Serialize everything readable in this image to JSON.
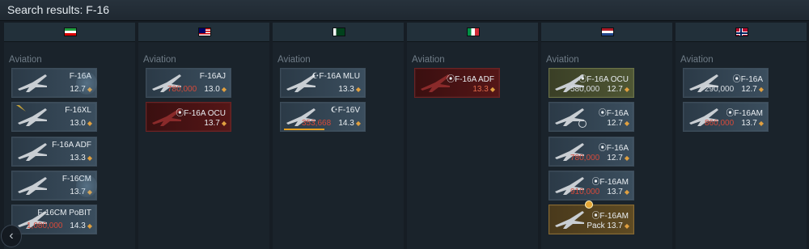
{
  "header": {
    "title": "Search results: F-16"
  },
  "colors": {
    "background": "#161d24",
    "accent_gold": "#e0a040",
    "price_red": "#d64a3a"
  },
  "columns": [
    {
      "country_flag": "iran-flag",
      "section": "Aviation",
      "cards": [
        {
          "name": "F-16A",
          "br": "12.7",
          "price": "",
          "style": "normal"
        },
        {
          "name": "F-16XL",
          "br": "13.0",
          "price": "",
          "style": "normal"
        },
        {
          "name": "F-16A ADF",
          "br": "13.3",
          "price": "",
          "style": "normal"
        },
        {
          "name": "F-16CM",
          "br": "13.7",
          "price": "",
          "style": "normal"
        },
        {
          "name": "F-16CM PoBIT",
          "br": "14.3",
          "price": "1,080,000",
          "style": "normal"
        }
      ]
    },
    {
      "country_flag": "malaysia-flag",
      "section": "Aviation",
      "cards": [
        {
          "name": "F-16AJ",
          "br": "13.0",
          "price": "780,000",
          "style": "normal"
        },
        {
          "name": "⦿F-16A OCU",
          "br": "13.7",
          "price": "",
          "style": "red"
        }
      ]
    },
    {
      "country_flag": "pakistan-flag",
      "section": "Aviation",
      "cards": [
        {
          "name": "☪F-16A MLU",
          "br": "13.3",
          "price": "",
          "style": "normal"
        },
        {
          "name": "☪F-16V",
          "br": "14.3",
          "price": "353,668",
          "style": "normal"
        }
      ]
    },
    {
      "country_flag": "italy-flag",
      "section": "Aviation",
      "cards": [
        {
          "name": "⦿F-16A ADF",
          "br": "13.3",
          "price": "",
          "style": "red"
        }
      ]
    },
    {
      "country_flag": "netherlands-flag",
      "section": "Aviation",
      "cards": [
        {
          "name": "⦿F-16A OCU",
          "br": "12.7",
          "price": "580,000",
          "style": "olive"
        },
        {
          "name": "⦿F-16A",
          "br": "12.7",
          "price": "",
          "style": "normal"
        },
        {
          "name": "⦿F-16A",
          "br": "12.7",
          "price": "780,000",
          "style": "normal"
        },
        {
          "name": "⦿F-16AM",
          "br": "13.7",
          "price": "910,000",
          "style": "normal"
        },
        {
          "name": "⦿F-16AM",
          "br": "13.7",
          "price": "Pack",
          "style": "gold"
        }
      ]
    },
    {
      "country_flag": "norway-flag",
      "section": "Aviation",
      "cards": [
        {
          "name": "⦿F-16A",
          "br": "12.7",
          "price": "290,000",
          "style": "normal"
        },
        {
          "name": "⦿F-16AM",
          "br": "13.7",
          "price": "860,000",
          "style": "normal"
        }
      ]
    }
  ],
  "nav": {
    "scroll_left_icon": "chevron-left-icon",
    "scroll_left_glyph": "‹"
  }
}
